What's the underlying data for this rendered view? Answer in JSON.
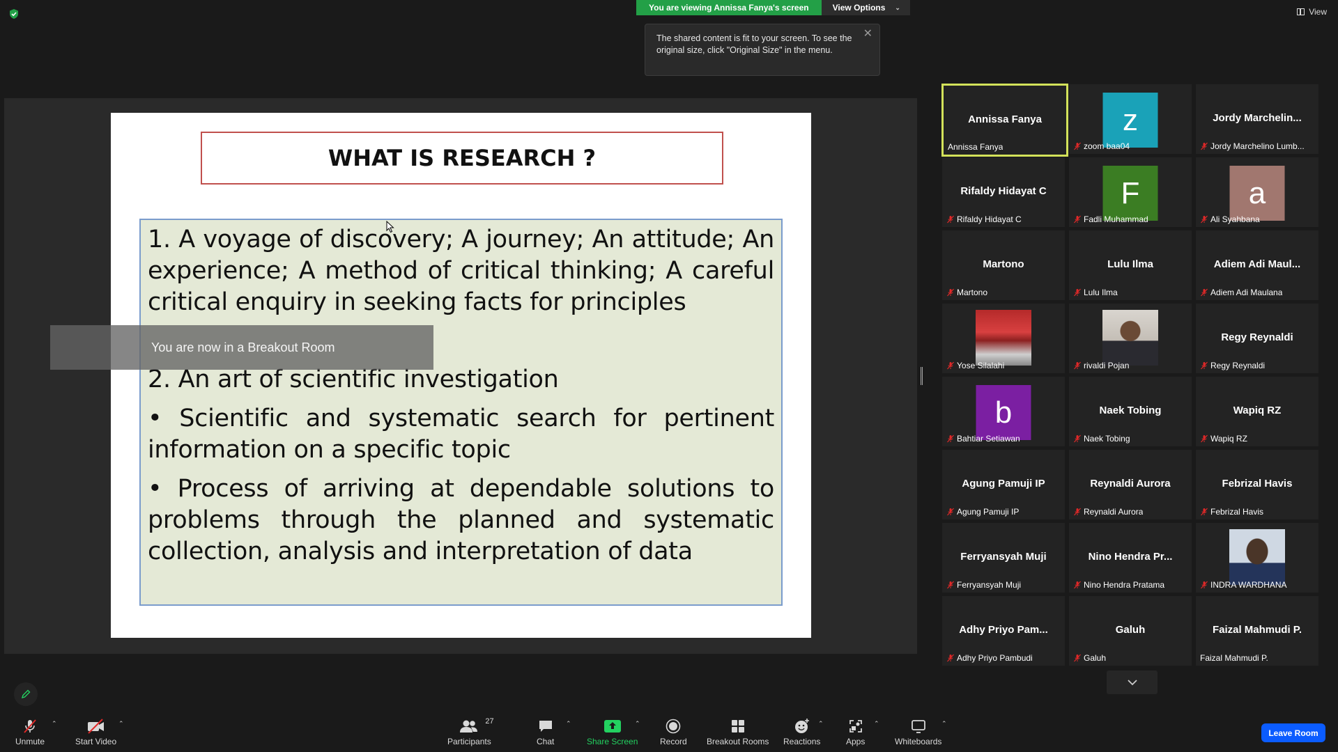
{
  "top": {
    "view_label": "View",
    "viewing_banner": "You are viewing Annissa Fanya's screen",
    "view_options": "View Options"
  },
  "tooltip": {
    "text": "The shared content is fit to your screen. To see the original size, click \"Original Size\" in the menu."
  },
  "slide": {
    "title": "WHAT IS RESEARCH ?",
    "p1": "1. A voyage of discovery; A journey; An attitude; An experience; A method of critical thinking; A careful critical enquiry in seeking facts for principles",
    "p2": "2. An art of scientific investigation",
    "p3": "• Scientific and systematic search for pertinent information on a specific topic",
    "p4": "• Process of arriving at dependable solutions to problems through the planned and systematic collection, analysis and interpretation of data"
  },
  "breakout_toast": "You are now in a Breakout Room",
  "gallery": [
    {
      "name": "Annissa Fanya",
      "label": "Annissa Fanya",
      "muted": false,
      "active": true
    },
    {
      "name": "",
      "label": "zoom baa04",
      "muted": true,
      "avatar": "z",
      "avatar_color": "#1aa2b8"
    },
    {
      "name": "Jordy  Marchelin...",
      "label": "Jordy Marchelino Lumb...",
      "muted": true
    },
    {
      "name": "Rifaldy Hidayat C",
      "label": "Rifaldy Hidayat C",
      "muted": true
    },
    {
      "name": "",
      "label": "Fadli Muhammad",
      "muted": true,
      "avatar": "F",
      "avatar_color": "#3b7d23"
    },
    {
      "name": "",
      "label": "Ali Syahbana",
      "muted": true,
      "avatar": "a",
      "avatar_color": "#a1776f"
    },
    {
      "name": "Martono",
      "label": "Martono",
      "muted": true
    },
    {
      "name": "Lulu Ilma",
      "label": "Lulu Ilma",
      "muted": true
    },
    {
      "name": "Adiem  Adi  Maul...",
      "label": "Adiem Adi Maulana",
      "muted": true
    },
    {
      "name": "",
      "label": "Yose Silalahi",
      "muted": true,
      "photo": "red"
    },
    {
      "name": "",
      "label": "rivaldi Pojan",
      "muted": true,
      "photo": "person"
    },
    {
      "name": "Regy Reynaldi",
      "label": "Regy Reynaldi",
      "muted": true
    },
    {
      "name": "",
      "label": "Bahtiar Setiawan",
      "muted": true,
      "avatar": "b",
      "avatar_color": "#7b1fa2"
    },
    {
      "name": "Naek Tobing",
      "label": "Naek Tobing",
      "muted": true
    },
    {
      "name": "Wapiq RZ",
      "label": "Wapiq RZ",
      "muted": true
    },
    {
      "name": "Agung Pamuji IP",
      "label": "Agung Pamuji IP",
      "muted": true
    },
    {
      "name": "Reynaldi Aurora",
      "label": "Reynaldi Aurora",
      "muted": true
    },
    {
      "name": "Febrizal Havis",
      "label": "Febrizal Havis",
      "muted": true
    },
    {
      "name": "Ferryansyah Muji",
      "label": "Ferryansyah Muji",
      "muted": true
    },
    {
      "name": "Nino  Hendra  Pr...",
      "label": "Nino Hendra Pratama",
      "muted": true
    },
    {
      "name": "",
      "label": "INDRA WARDHANA",
      "muted": true,
      "photo": "portrait"
    },
    {
      "name": "Adhy  Priyo  Pam...",
      "label": "Adhy Priyo Pambudi",
      "muted": true
    },
    {
      "name": "Galuh",
      "label": "Galuh",
      "muted": true
    },
    {
      "name": "Faizal Mahmudi P.",
      "label": "Faizal Mahmudi P.",
      "muted": false
    }
  ],
  "toolbar": {
    "unmute": "Unmute",
    "start_video": "Start Video",
    "participants": "Participants",
    "participants_count": "27",
    "chat": "Chat",
    "share_screen": "Share Screen",
    "record": "Record",
    "breakout_rooms": "Breakout Rooms",
    "reactions": "Reactions",
    "apps": "Apps",
    "whiteboards": "Whiteboards",
    "leave_room": "Leave Room"
  },
  "colors": {
    "accent_green": "#23a047",
    "active_speaker_border": "#d3e25a",
    "leave_blue": "#0b5cff",
    "muted_red": "#e02828"
  }
}
